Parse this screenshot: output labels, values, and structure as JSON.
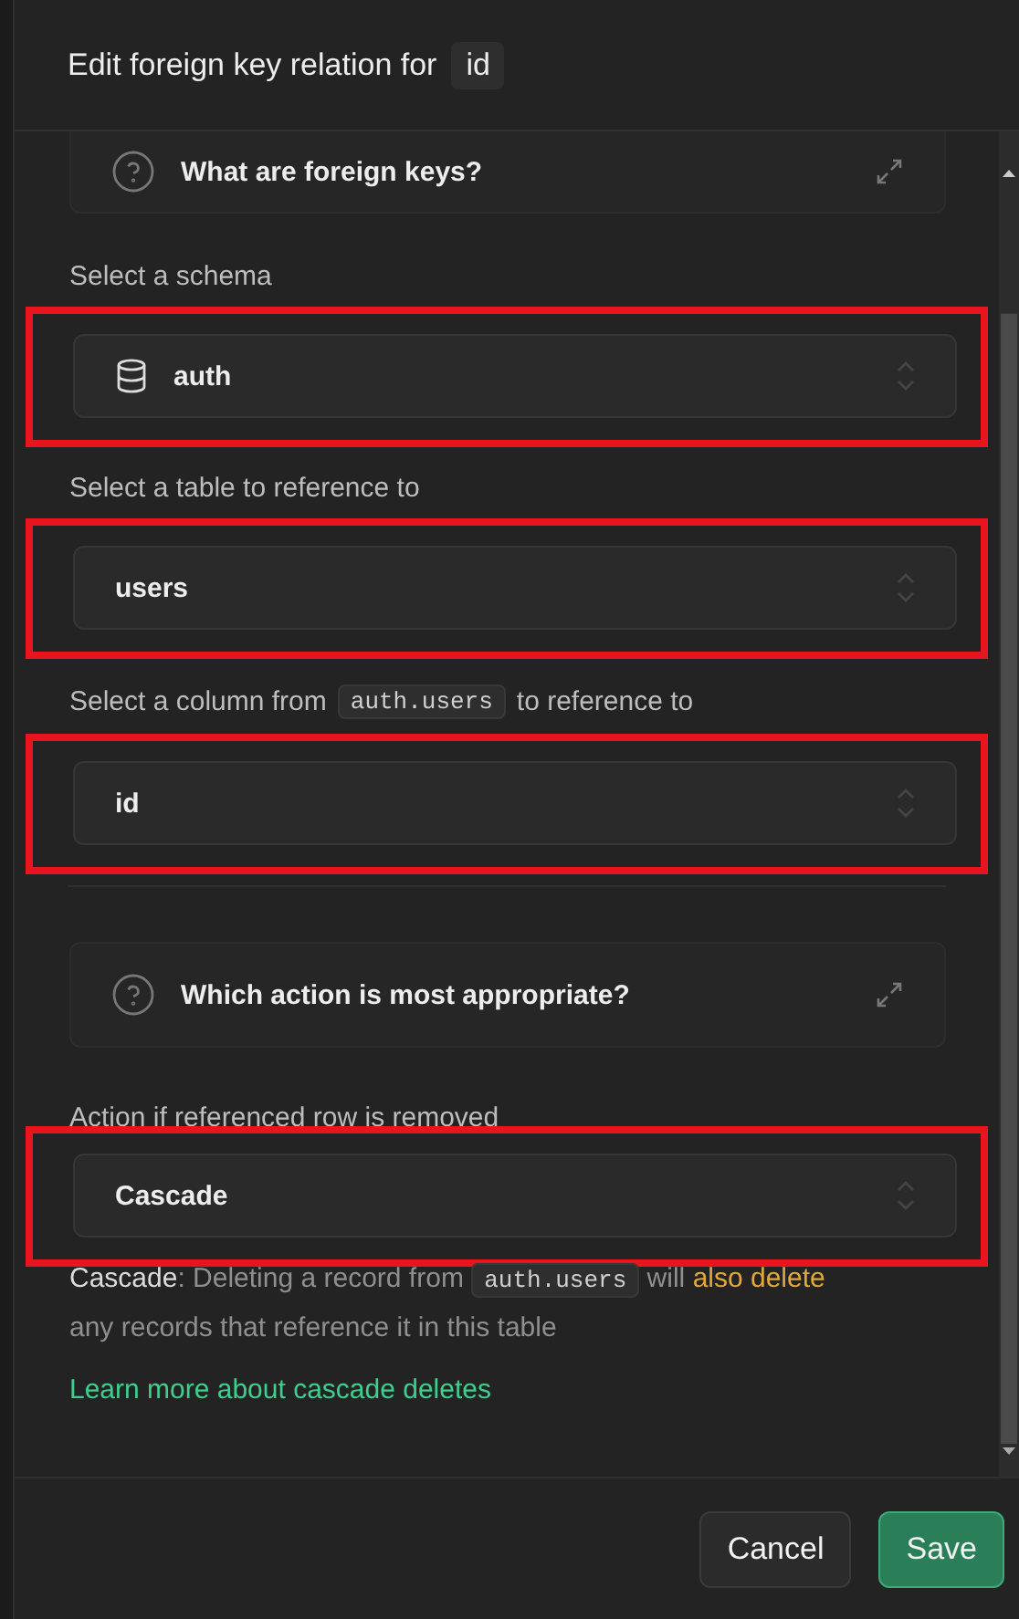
{
  "dialog": {
    "title": "Edit foreign key relation for",
    "title_code": "id"
  },
  "help_panels": [
    {
      "text": "What are foreign keys?"
    },
    {
      "text": "Which action is most appropriate?"
    }
  ],
  "fields": [
    {
      "label": [
        {
          "kind": "plain",
          "text": "Select a schema"
        }
      ],
      "value": "auth",
      "kind": "schema",
      "highlighted": true
    },
    {
      "label": [
        {
          "kind": "plain",
          "text": "Select a table to reference to"
        }
      ],
      "value": "users",
      "kind": "table",
      "highlighted": true
    },
    {
      "label": [
        {
          "kind": "plain",
          "text": "Select a column from"
        },
        {
          "kind": "code",
          "text": "auth.users"
        },
        {
          "kind": "plain",
          "text": "to reference to"
        }
      ],
      "value": "id",
      "kind": "column",
      "highlighted": true
    }
  ],
  "action": {
    "label": "Action if referenced row is removed",
    "value": "Cascade",
    "highlighted": true,
    "description": [
      {
        "kind": "lead",
        "text": "Cascade"
      },
      {
        "kind": "plain",
        "text": ": Deleting a record from"
      },
      {
        "kind": "code",
        "text": "auth.users"
      },
      {
        "kind": "plain",
        "text": "will"
      },
      {
        "kind": "warn",
        "text": "also delete"
      },
      {
        "kind": "plain",
        "text": "any records that reference it in this table"
      }
    ],
    "link": "Learn more about cascade deletes"
  },
  "buttons": [
    {
      "label": "Cancel",
      "kind": "secondary"
    },
    {
      "label": "Save",
      "kind": "primary"
    }
  ]
}
